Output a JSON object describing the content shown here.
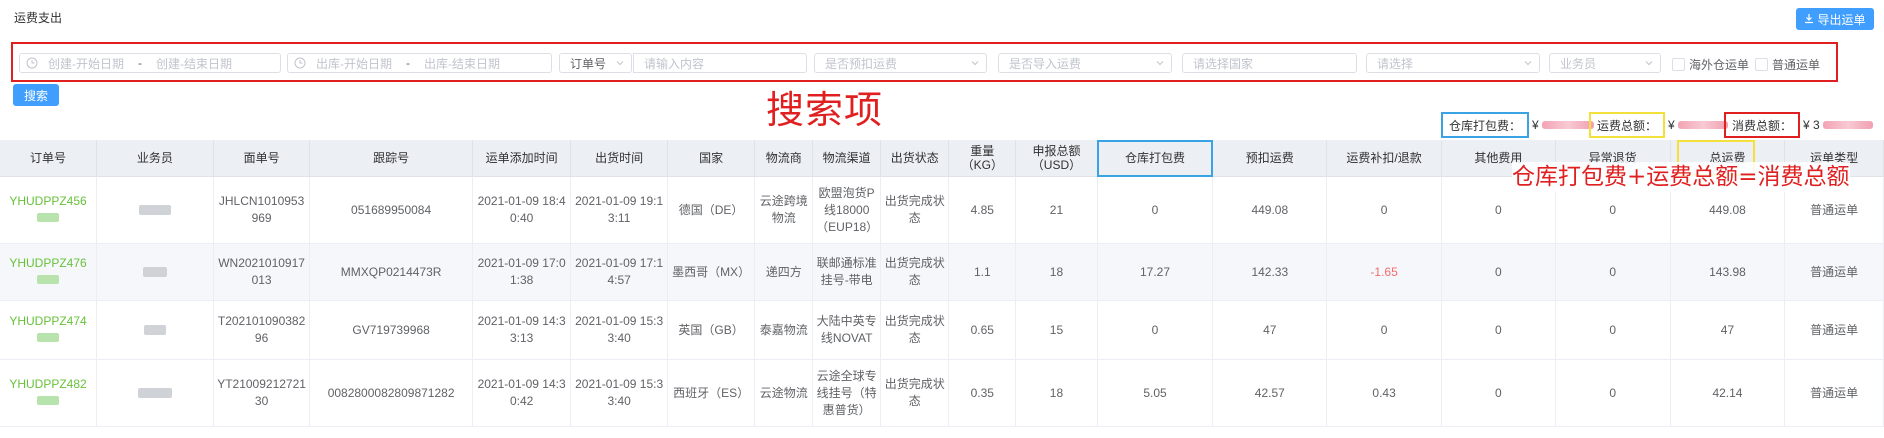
{
  "page": {
    "title": "运费支出",
    "export_label": "导出运单",
    "search_label": "搜索"
  },
  "filters": {
    "create_start": "创建-开始日期",
    "range_sep": "-",
    "create_end": "创建-结束日期",
    "out_start": "出库-开始日期",
    "out_end": "出库-结束日期",
    "order_type": "订单号",
    "content_placeholder": "请输入内容",
    "prepaid": "是否预扣运费",
    "imported": "是否导入运费",
    "country": "请选择国家",
    "select": "请选择",
    "salesman": "业务员",
    "check_overseas": "海外仓运单",
    "check_normal": "普通运单"
  },
  "annotations": {
    "search_items": "搜索项",
    "formula": "仓库打包费+运费总额=消费总额"
  },
  "summary": {
    "warehouse_label": "仓库打包费：",
    "warehouse_currency": "¥",
    "freight_label": "运费总额：",
    "freight_currency": "¥",
    "consume_label": "消费总额：",
    "consume_currency": "¥ 3",
    "colors": {
      "warehouse": "#39a3e3",
      "freight": "#f3e03a",
      "consume": "#e02020"
    }
  },
  "table": {
    "headers": [
      "订单号",
      "业务员",
      "面单号",
      "跟踪号",
      "运单添加时间",
      "出货时间",
      "国家",
      "物流商",
      "物流渠道",
      "出货状态",
      "重量（KG）",
      "申报总额（USD）",
      "仓库打包费",
      "预扣运费",
      "运费补扣/退款",
      "其他费用",
      "异常退货",
      "总运费",
      "运单类型"
    ],
    "rows": [
      {
        "order": "YHUDPPZ456",
        "face": "JHLCN1010953969",
        "tracking": "051689950084",
        "added": "2021-01-09 18:40:40",
        "shipped": "2021-01-09 19:13:11",
        "country": "德国（DE）",
        "carrier": "云途跨境物流",
        "channel": "欧盟泡货P线18000（EUP18）",
        "status": "出货完成状态",
        "weight": "4.85",
        "declared": "21",
        "pack": "0",
        "prepaid": "449.08",
        "adjust": "0",
        "other": "0",
        "abnormal": "0",
        "total": "449.08",
        "type": "普通运单"
      },
      {
        "order": "YHUDPPZ476",
        "face": "WN2021010917013",
        "tracking": "MMXQP0214473R",
        "added": "2021-01-09 17:01:38",
        "shipped": "2021-01-09 17:14:57",
        "country": "墨西哥（MX）",
        "carrier": "递四方",
        "channel": "联邮通标准挂号-带电",
        "status": "出货完成状态",
        "weight": "1.1",
        "declared": "18",
        "pack": "17.27",
        "prepaid": "142.33",
        "adjust": "-1.65",
        "other": "0",
        "abnormal": "0",
        "total": "143.98",
        "type": "普通运单"
      },
      {
        "order": "YHUDPPZ474",
        "face": "T20210109038296",
        "tracking": "GV719739968",
        "added": "2021-01-09 14:33:13",
        "shipped": "2021-01-09 15:33:40",
        "country": "英国（GB）",
        "carrier": "泰嘉物流",
        "channel": "大陆中英专线NOVAT",
        "status": "出货完成状态",
        "weight": "0.65",
        "declared": "15",
        "pack": "0",
        "prepaid": "47",
        "adjust": "0",
        "other": "0",
        "abnormal": "0",
        "total": "47",
        "type": "普通运单"
      },
      {
        "order": "YHUDPPZ482",
        "face": "YT2100921272130",
        "tracking": "0082800082809871282",
        "added": "2021-01-09 14:30:42",
        "shipped": "2021-01-09 15:33:40",
        "country": "西班牙（ES）",
        "carrier": "云途物流",
        "channel": "云途全球专线挂号（特惠普货）",
        "status": "出货完成状态",
        "weight": "0.35",
        "declared": "18",
        "pack": "5.05",
        "prepaid": "42.57",
        "adjust": "0.43",
        "other": "0",
        "abnormal": "0",
        "total": "42.14",
        "type": "普通运单"
      }
    ]
  }
}
